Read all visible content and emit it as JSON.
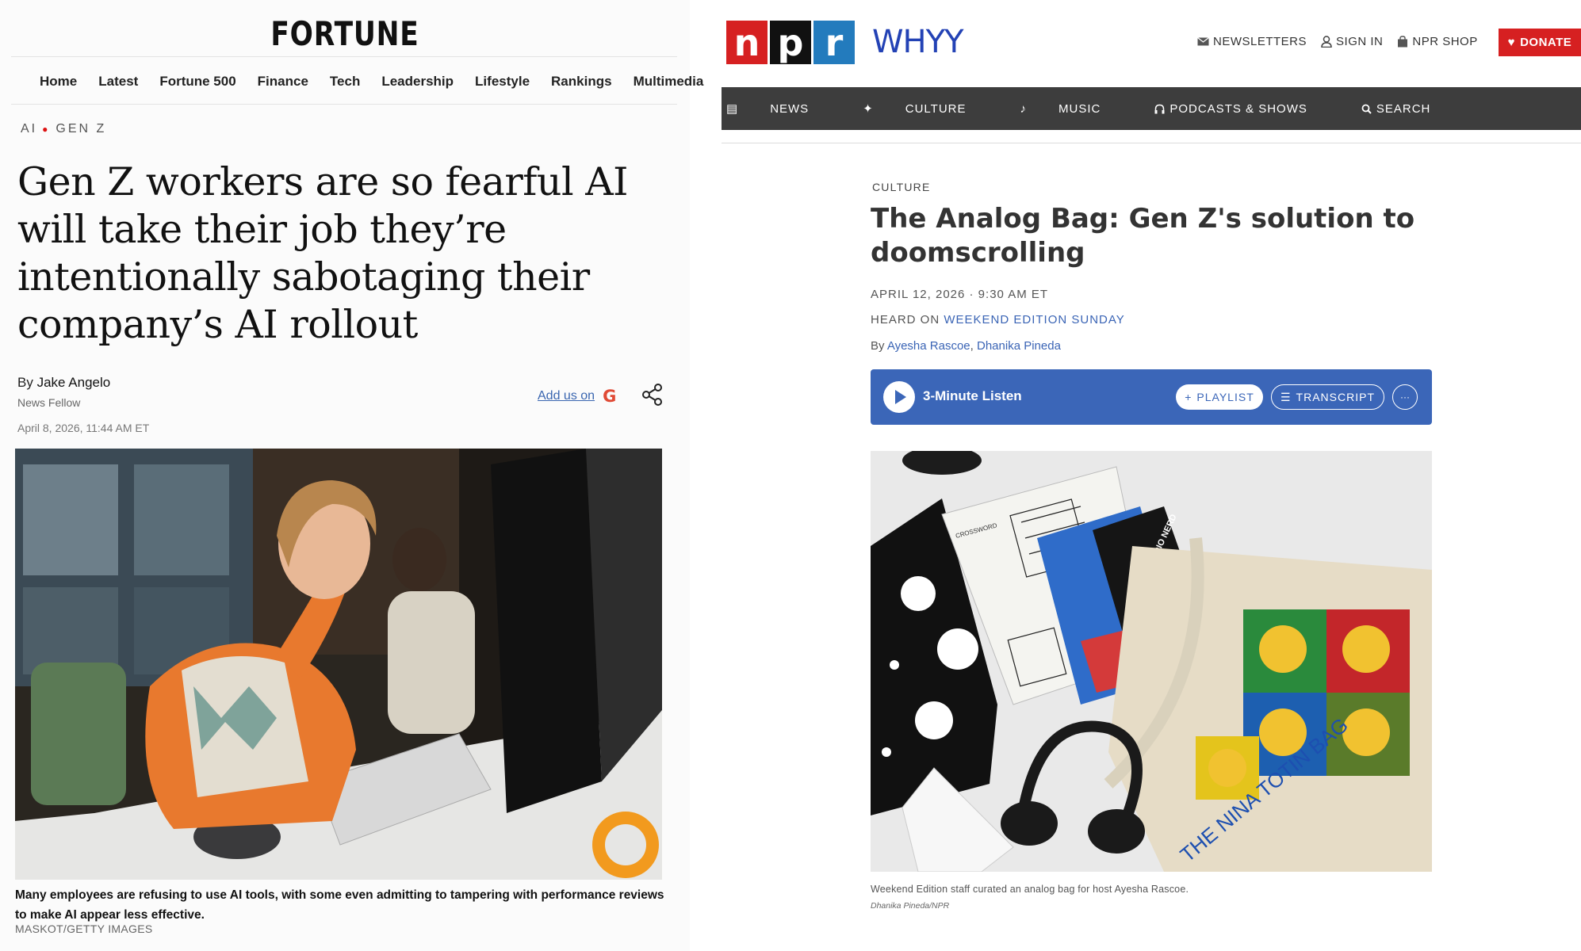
{
  "fortune": {
    "logo": "FORTUNE",
    "nav": [
      "Home",
      "Latest",
      "Fortune 500",
      "Finance",
      "Tech",
      "Leadership",
      "Lifestyle",
      "Rankings",
      "Multimedia"
    ],
    "breadcrumbs": [
      "AI",
      "GEN Z"
    ],
    "headline": "Gen Z workers are so fearful AI will take their job they’re intentionally sabotaging their company’s AI rollout",
    "byline_prefix": "By",
    "author": "Jake Angelo",
    "author_role": "News Fellow",
    "date": "April 8, 2026, 11:44 AM ET",
    "add_us_label": "Add us on",
    "caption": "Many employees are refusing to use AI tools, with some even admitting to tampering with performance reviews to make AI appear less effective.",
    "credit": "MASKOT/GETTY IMAGES",
    "colors": {
      "accent_red": "#dd1111",
      "link_blue": "#3a66b0"
    }
  },
  "npr": {
    "logo_letters": [
      "n",
      "p",
      "r"
    ],
    "station": "WHYY",
    "utility": [
      {
        "label": "NEWSLETTERS",
        "icon": "envelope-icon"
      },
      {
        "label": "SIGN IN",
        "icon": "user-icon"
      },
      {
        "label": "NPR SHOP",
        "icon": "shopping-bag-icon"
      }
    ],
    "donate_label": "DONATE",
    "nav": [
      {
        "label": "NEWS",
        "icon": "news-icon"
      },
      {
        "label": "CULTURE",
        "icon": "culture-icon"
      },
      {
        "label": "MUSIC",
        "icon": "music-note-icon"
      },
      {
        "label": "PODCASTS & SHOWS",
        "icon": "headphones-icon"
      },
      {
        "label": "SEARCH",
        "icon": "search-icon"
      }
    ],
    "slug": "CULTURE",
    "headline": "The Analog Bag: Gen Z's solution to doomscrolling",
    "date": "APRIL 12, 2026 · 9:30 AM ET",
    "heard_on_prefix": "HEARD ON",
    "heard_on_show": "WEEKEND EDITION SUNDAY",
    "by_prefix": "By",
    "authors": [
      "Ayesha Rascoe",
      "Dhanika Pineda"
    ],
    "author_separator": ",",
    "player": {
      "listen_label": "3-Minute Listen",
      "playlist_label": "PLAYLIST",
      "transcript_label": "TRANSCRIPT",
      "more_label": "···"
    },
    "caption": "Weekend Edition staff curated an analog bag for host Ayesha Rascoe.",
    "credit": "Dhanika Pineda/NPR",
    "photo_text": {
      "crossword_title": "CROSSWORD",
      "card_text": "PUBLIC RADIO NERD",
      "tote_text": "THE NINA TOTIN BAG"
    },
    "colors": {
      "red": "#d62021",
      "blue": "#237bbd",
      "station_blue": "#2342b5",
      "player_blue": "#3b66b8",
      "nav_bg": "#3d3d3d"
    }
  }
}
